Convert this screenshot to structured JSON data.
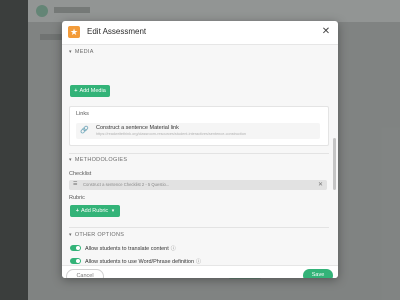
{
  "modal": {
    "title": "Edit Assessment",
    "close_symbol": "✕",
    "header_icon": "star-icon"
  },
  "media": {
    "section_title": "MEDIA",
    "add_button": "Add Media",
    "links_label": "Links",
    "link_title": "Construct a sentence Material link",
    "link_url": "https://readwritethink.org/classroom-resources/student-interactives/sentence-construction"
  },
  "methodologies": {
    "section_title": "METHODOLOGIES",
    "checklist_label": "Checklist",
    "checklist_value": "Construct a sentence Checklist 2 - 5 Questio...",
    "rubric_label": "Rubric",
    "add_rubric_button": "Add Rubric"
  },
  "other_options": {
    "section_title": "OTHER OPTIONS",
    "option1": "Allow students to translate content",
    "option2": "Allow students to use Word/Phrase definition",
    "option1_on": true,
    "option2_on": true
  },
  "footer": {
    "cancel": "Cancel",
    "save": "Save"
  },
  "colors": {
    "accent": "#33b378",
    "header_icon": "#f39c3a"
  }
}
